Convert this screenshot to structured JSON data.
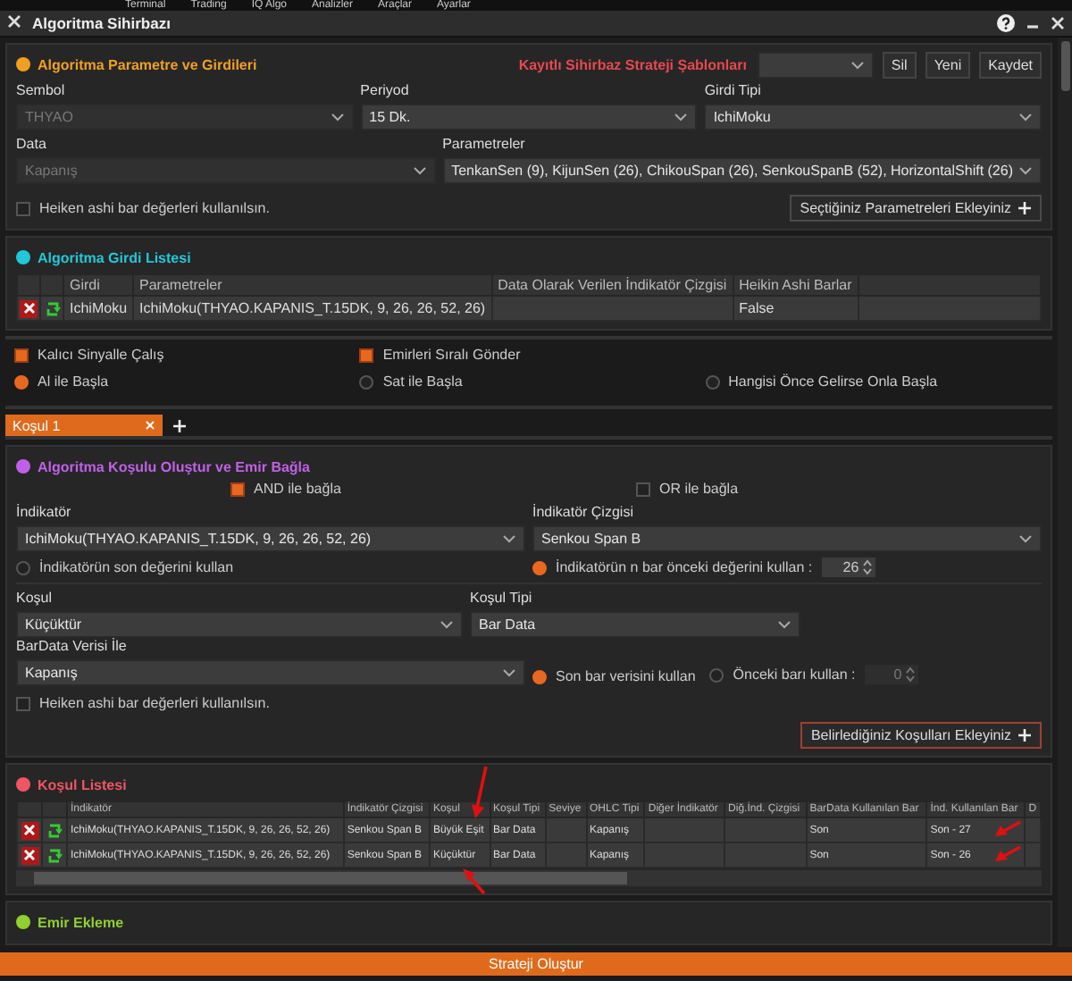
{
  "menu": [
    "Terminal",
    "Trading",
    "IQ Algo",
    "Analizler",
    "Araçlar",
    "Ayarlar"
  ],
  "window": {
    "title": "Algoritma Sihirbazı"
  },
  "params": {
    "title": "Algoritma Parametre ve Girdileri",
    "templates_label": "Kayıtlı Sihirbaz Strateji Şablonları",
    "template_buttons": [
      "Sil",
      "Yeni",
      "Kaydet"
    ],
    "row1": [
      {
        "label": "Sembol",
        "value": "THYAO",
        "disabled": true
      },
      {
        "label": "Periyod",
        "value": "15 Dk.",
        "disabled": false
      },
      {
        "label": "Girdi Tipi",
        "value": "IchiMoku",
        "disabled": false
      }
    ],
    "row2": [
      {
        "label": "Data",
        "value": "Kapanış",
        "disabled": true
      },
      {
        "label": "Parametreler",
        "value": "TenkanSen (9), KijunSen (26), ChikouSpan (26), SenkouSpanB (52), HorizontalShift (26)",
        "disabled": false
      }
    ],
    "heiken": {
      "label": "Heiken ashi bar değerleri kullanılsın.",
      "checked": false
    },
    "add_button": "Seçtiğiniz Parametreleri Ekleyiniz"
  },
  "inputs": {
    "title": "Algoritma Girdi Listesi",
    "columns": [
      "Girdi",
      "Parametreler",
      "Data Olarak Verilen İndikatör Çizgisi",
      "Heikin Ashi Barlar"
    ],
    "rows": [
      [
        "IchiMoku",
        "IchiMoku(THYAO.KAPANIS_T.15DK, 9, 26, 26, 52, 26)",
        "",
        "False"
      ]
    ]
  },
  "options": {
    "checks": [
      {
        "label": "Kalıcı Sinyalle Çalış",
        "checked": true
      },
      {
        "label": "Emirleri Sıralı Gönder",
        "checked": true
      }
    ],
    "radios": [
      {
        "label": "Al ile Başla",
        "selected": true
      },
      {
        "label": "Sat ile Başla",
        "selected": false
      },
      {
        "label": "Hangisi Önce Gelirse Onla Başla",
        "selected": false
      }
    ]
  },
  "tabs": [
    {
      "label": "Koşul 1",
      "selected": true
    }
  ],
  "condition": {
    "title": "Algoritma Koşulu Oluştur ve Emir Bağla",
    "links": [
      {
        "label": "AND ile bağla",
        "checked": true
      },
      {
        "label": "OR ile bağla",
        "checked": false
      }
    ],
    "indicator": {
      "label": "İndikatör",
      "value": "IchiMoku(THYAO.KAPANIS_T.15DK, 9, 26, 26, 52, 26)"
    },
    "line": {
      "label": "İndikatör Çizgisi",
      "value": "Senkou Span B"
    },
    "value_radios": [
      {
        "label": "İndikatörün son değerini kullan",
        "selected": false
      },
      {
        "label": "İndikatörün n bar önceki değerini kullan :",
        "selected": true
      }
    ],
    "n_bars": "26",
    "kosul": {
      "label": "Koşul",
      "value": "Küçüktür"
    },
    "kosul_tipi": {
      "label": "Koşul Tipi",
      "value": "Bar Data"
    },
    "bardata": {
      "label": "BarData Verisi İle",
      "value": "Kapanış"
    },
    "bar_radios": [
      {
        "label": "Son bar verisini kullan",
        "selected": true
      },
      {
        "label": "Önceki barı kullan :",
        "selected": false
      }
    ],
    "prev_bars": "0",
    "heiken": {
      "label": "Heiken ashi bar değerleri kullanılsın.",
      "checked": false
    },
    "add_button": "Belirlediğiniz Koşulları Ekleyiniz"
  },
  "conditions": {
    "title": "Koşul Listesi",
    "columns": [
      "İndikatör",
      "İndikatör Çizgisi",
      "Koşul",
      "Koşul Tipi",
      "Seviye",
      "OHLC Tipi",
      "Diğer İndikatör",
      "Diğ.İnd. Çizgisi",
      "BarData Kullanılan Bar",
      "İnd. Kullanılan Bar",
      "D"
    ],
    "rows": [
      [
        "IchiMoku(THYAO.KAPANIS_T.15DK, 9, 26, 26, 52, 26)",
        "Senkou Span B",
        "Büyük Eşit",
        "Bar Data",
        "",
        "Kapanış",
        "",
        "",
        "Son",
        "Son - 27",
        ""
      ],
      [
        "IchiMoku(THYAO.KAPANIS_T.15DK, 9, 26, 26, 52, 26)",
        "Senkou Span B",
        "Küçüktür",
        "Bar Data",
        "",
        "Kapanış",
        "",
        "",
        "Son",
        "Son - 26",
        ""
      ]
    ]
  },
  "orders": {
    "title": "Emir Ekleme"
  },
  "submit": "Strateji Oluştur"
}
